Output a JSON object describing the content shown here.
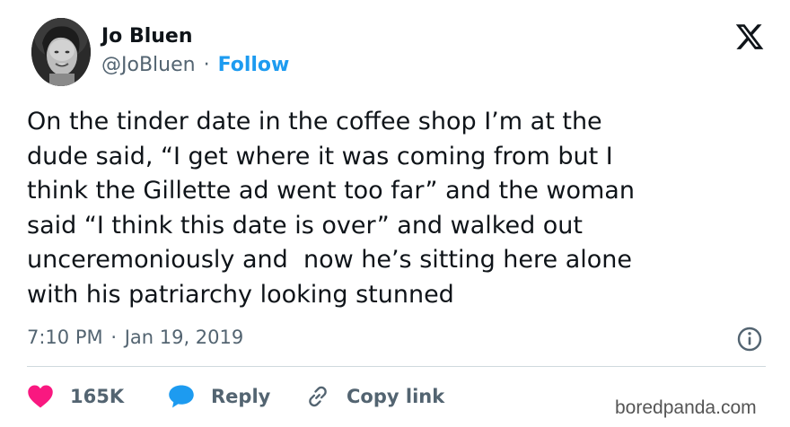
{
  "author": {
    "name": "Jo Bluen",
    "handle": "@JoBluen",
    "separator": "·",
    "follow_label": "Follow"
  },
  "tweet": {
    "text_lines": [
      "On the tinder date in the coffee shop I’m at the",
      "dude said, “I get where it was coming from but I",
      "think the Gillette ad went too far” and the woman",
      "said “I think this date is over” and walked out",
      "unceremoniously and  now he’s sitting here alone",
      "with his patriarchy looking stunned"
    ],
    "time": "7:10 PM",
    "date": "Jan 19, 2019",
    "meta_separator": "·"
  },
  "actions": {
    "likes_count": "165K",
    "reply_label": "Reply",
    "copy_link_label": "Copy link"
  },
  "icons": {
    "platform": "x-logo-icon",
    "info": "info-icon",
    "like": "heart-icon",
    "reply": "speech-bubble-icon",
    "copy": "link-icon"
  },
  "colors": {
    "follow": "#1d9bf0",
    "heart": "#f91880",
    "reply_bubble": "#1d9bf0",
    "secondary_text": "#536471",
    "primary_text": "#0f1419"
  },
  "watermark": "boredpanda.com"
}
